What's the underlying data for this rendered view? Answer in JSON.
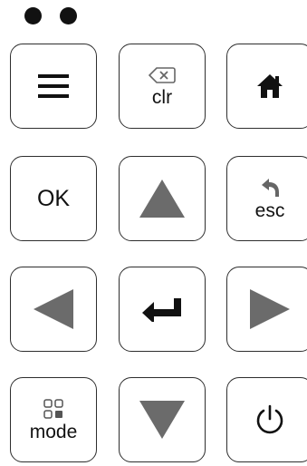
{
  "status": {
    "indicator_count": 2
  },
  "keys": {
    "menu": {
      "icon": "hamburger-menu-icon"
    },
    "clear": {
      "label": "clr",
      "icon": "backspace-icon"
    },
    "home": {
      "icon": "home-icon"
    },
    "ok": {
      "label": "OK"
    },
    "up": {
      "icon": "triangle-up-icon"
    },
    "escape": {
      "label": "esc",
      "icon": "back-arrow-icon"
    },
    "left": {
      "icon": "triangle-left-icon"
    },
    "enter": {
      "icon": "enter-arrow-icon"
    },
    "right": {
      "icon": "triangle-right-icon"
    },
    "mode": {
      "label": "mode",
      "icon": "grid-squares-icon"
    },
    "down": {
      "icon": "triangle-down-icon"
    },
    "power": {
      "icon": "power-icon"
    }
  },
  "colors": {
    "icon_dark": "#111111",
    "icon_gray": "#6b6b6b",
    "border": "#2e2e2e"
  }
}
